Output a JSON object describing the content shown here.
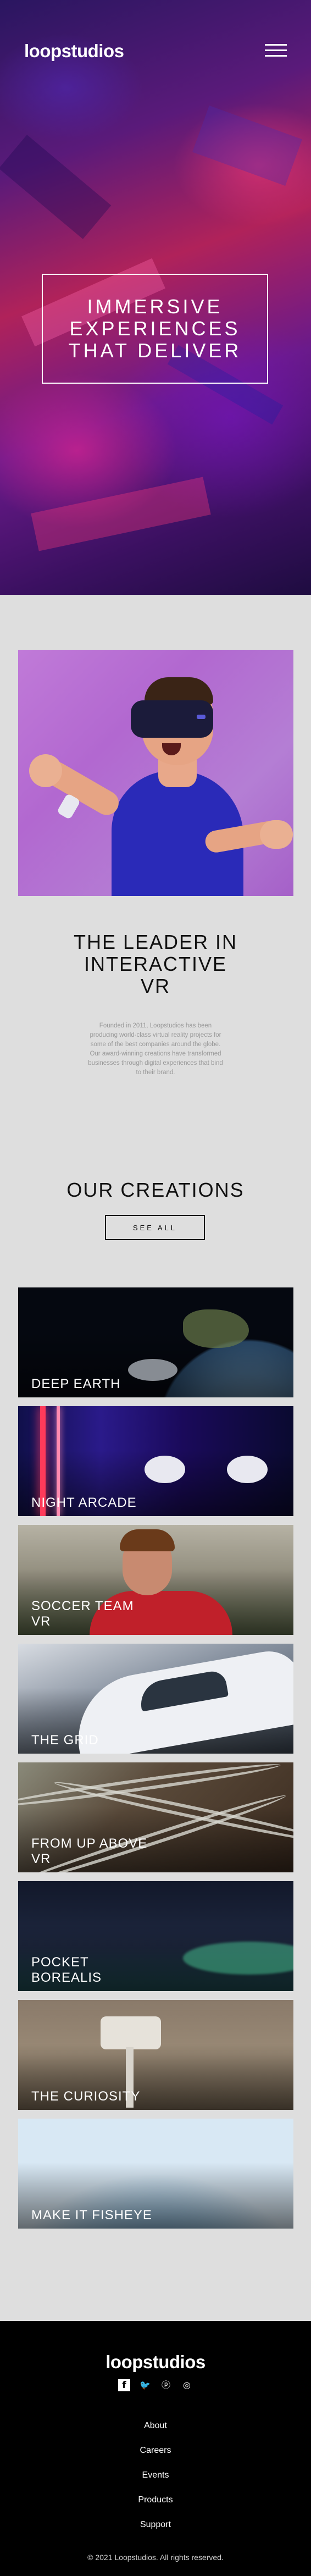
{
  "header": {
    "logo": "loopstudios",
    "menu_icon": "hamburger-menu-icon"
  },
  "hero": {
    "title": "IMMERSIVE EXPERIENCES THAT DELIVER"
  },
  "interactive": {
    "title": "THE LEADER IN INTERACTIVE VR",
    "text": "Founded in 2011, Loopstudios has been producing world-class virtual reality projects for some of the best companies around the globe. Our award-winning creations have transformed businesses through digital experiences that bind to their brand."
  },
  "creations": {
    "title": "OUR CREATIONS",
    "see_all_label": "SEE ALL",
    "items": [
      {
        "label": "DEEP EARTH"
      },
      {
        "label": "NIGHT ARCADE"
      },
      {
        "label": "SOCCER TEAM VR"
      },
      {
        "label": "THE GRID"
      },
      {
        "label": "FROM UP ABOVE VR"
      },
      {
        "label": "POCKET BOREALIS"
      },
      {
        "label": "THE CURIOSITY"
      },
      {
        "label": "MAKE IT FISHEYE"
      }
    ]
  },
  "footer": {
    "logo": "loopstudios",
    "social_icons": [
      "facebook-icon",
      "twitter-icon",
      "pinterest-icon",
      "instagram-icon"
    ],
    "nav": [
      {
        "label": "About"
      },
      {
        "label": "Careers"
      },
      {
        "label": "Events"
      },
      {
        "label": "Products"
      },
      {
        "label": "Support"
      }
    ],
    "copyright": "© 2021 Loopstudios. All rights reserved."
  },
  "colors": {
    "background": "#dedede",
    "footer_background": "#000000",
    "text_on_dark": "#ffffff"
  }
}
